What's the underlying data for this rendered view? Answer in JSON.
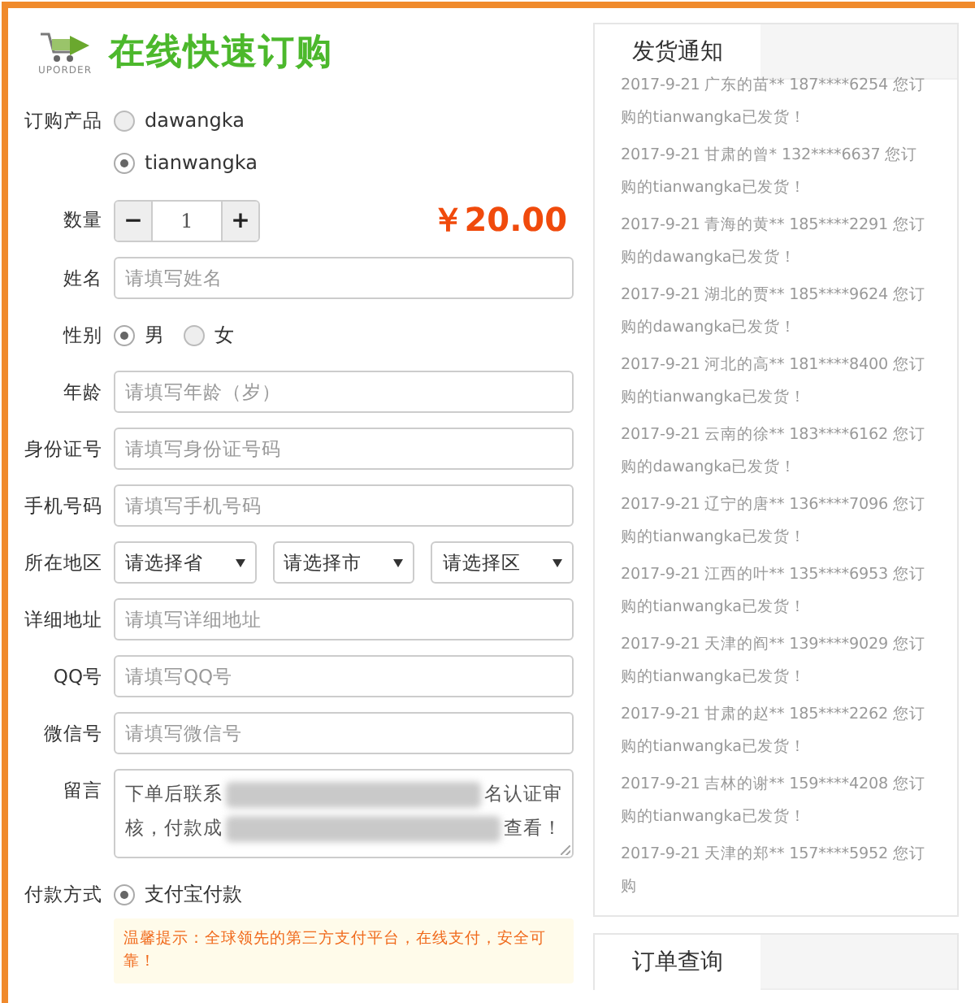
{
  "logo": {
    "caption": "UPORDER",
    "title": "在线快速订购"
  },
  "form": {
    "product": {
      "label": "订购产品",
      "options": [
        {
          "label": "dawangka",
          "selected": false
        },
        {
          "label": "tianwangka",
          "selected": true
        }
      ]
    },
    "quantity": {
      "label": "数量",
      "minus": "−",
      "value": "1",
      "plus": "+",
      "price": "￥20.00"
    },
    "fields": [
      {
        "kind": "text",
        "label": "姓名",
        "placeholder": "请填写姓名"
      },
      {
        "kind": "radio",
        "label": "性别",
        "options": [
          {
            "label": "男",
            "selected": true
          },
          {
            "label": "女",
            "selected": false
          }
        ]
      },
      {
        "kind": "text",
        "label": "年龄",
        "placeholder": "请填写年龄（岁）"
      },
      {
        "kind": "text",
        "label": "身份证号",
        "placeholder": "请填写身份证号码"
      },
      {
        "kind": "text",
        "label": "手机号码",
        "placeholder": "请填写手机号码"
      },
      {
        "kind": "selects",
        "label": "所在地区",
        "selects": [
          "请选择省",
          "请选择市",
          "请选择区"
        ]
      },
      {
        "kind": "text",
        "label": "详细地址",
        "placeholder": "请填写详细地址"
      },
      {
        "kind": "text",
        "label": "QQ号",
        "placeholder": "请填写QQ号"
      },
      {
        "kind": "text",
        "label": "微信号",
        "placeholder": "请填写微信号"
      },
      {
        "kind": "textarea",
        "label": "留言",
        "lines": [
          [
            {
              "kind": "text",
              "text": "下单后联系"
            },
            {
              "kind": "blur"
            },
            {
              "kind": "text",
              "text": "名认证审"
            }
          ],
          [
            {
              "kind": "text",
              "text": "核，付款成"
            },
            {
              "kind": "blur"
            },
            {
              "kind": "text",
              "text": "查看！"
            }
          ]
        ]
      },
      {
        "kind": "radio",
        "label": "付款方式",
        "options": [
          {
            "label": "支付宝付款",
            "selected": true
          }
        ]
      }
    ],
    "tip": "温馨提示：全球领先的第三方支付平台，在线支付，安全可靠！"
  },
  "notices": {
    "tab": "发货通知",
    "items": [
      "2017-9-21 广东的苗** 187****6254 您订购的tianwangka已发货！",
      "2017-9-21 甘肃的曾* 132****6637 您订购的tianwangka已发货！",
      "2017-9-21 青海的黄** 185****2291 您订购的dawangka已发货！",
      "2017-9-21 湖北的贾** 185****9624 您订购的dawangka已发货！",
      "2017-9-21 河北的高** 181****8400 您订购的tianwangka已发货！",
      "2017-9-21 云南的徐** 183****6162 您订购的dawangka已发货！",
      "2017-9-21 辽宁的唐** 136****7096 您订购的tianwangka已发货！",
      "2017-9-21 江西的叶** 135****6953 您订购的tianwangka已发货！",
      "2017-9-21 天津的阎** 139****9029 您订购的tianwangka已发货！",
      "2017-9-21 甘肃的赵** 185****2262 您订购的tianwangka已发货！",
      "2017-9-21 吉林的谢** 159****4208 您订购的tianwangka已发货！",
      "2017-9-21 天津的郑** 157****5952 您订购"
    ]
  },
  "query": {
    "tab": "订单查询"
  }
}
